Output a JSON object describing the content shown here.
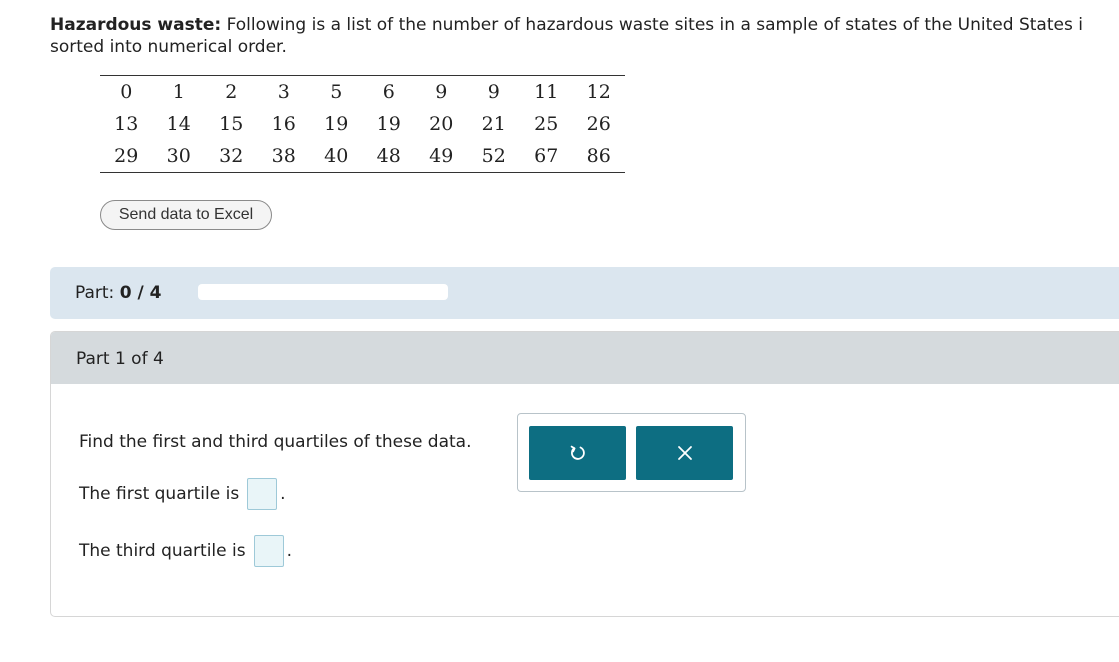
{
  "intro": {
    "bold_label": "Hazardous waste:",
    "text": " Following is a list of the number of hazardous waste sites in a sample of states of the United States i",
    "line2": "sorted into numerical order."
  },
  "data_rows": [
    [
      "0",
      "1",
      "2",
      "3",
      "5",
      "6",
      "9",
      "9",
      "11",
      "12"
    ],
    [
      "13",
      "14",
      "15",
      "16",
      "19",
      "19",
      "20",
      "21",
      "25",
      "26"
    ],
    [
      "29",
      "30",
      "32",
      "38",
      "40",
      "48",
      "49",
      "52",
      "67",
      "86"
    ]
  ],
  "excel_button": "Send data to Excel",
  "progress_bar": {
    "label": "Part:",
    "score": "0 / 4",
    "fraction": 0
  },
  "section": {
    "title": "Part 1 of 4",
    "question": "Find the first and third quartiles of these data.",
    "first_label": "The first quartile is",
    "third_label": "The third quartile is",
    "first_value": "",
    "third_value": "",
    "period": "."
  },
  "tools": {
    "undo_icon": "undo-icon",
    "clear_icon": "close-icon"
  },
  "colors": {
    "accent": "#0d6e82",
    "part_bar_bg": "#dbe6ef",
    "section_head_bg": "#d5dadd"
  }
}
